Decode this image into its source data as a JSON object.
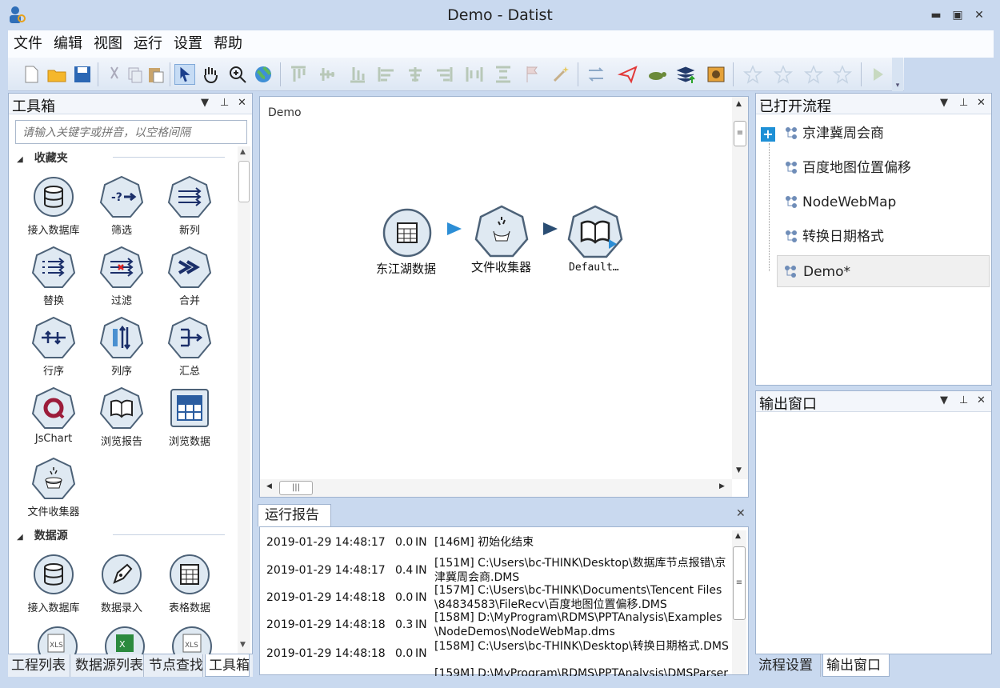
{
  "window": {
    "title": "Demo - Datist",
    "minimize": "▬",
    "maximize": "▣",
    "close": "✕"
  },
  "menu": [
    "文件",
    "编辑",
    "视图",
    "运行",
    "设置",
    "帮助"
  ],
  "toolbox": {
    "title": "工具箱",
    "search_placeholder": "请输入关键字或拼音，以空格间隔",
    "favorites_label": "收藏夹",
    "favorites": [
      "接入数据库",
      "筛选",
      "新列",
      "替换",
      "过滤",
      "合并",
      "行序",
      "列序",
      "汇总",
      "JsChart",
      "浏览报告",
      "浏览数据",
      "文件收集器"
    ],
    "datasource_label": "数据源",
    "datasource": [
      "接入数据库",
      "数据录入",
      "表格数据"
    ],
    "bottom_tabs": [
      "工程列表",
      "数据源列表",
      "节点查找",
      "工具箱"
    ]
  },
  "canvas": {
    "title": "Demo",
    "nodes": [
      "东江湖数据",
      "文件收集器",
      "Default…"
    ]
  },
  "report": {
    "title": "运行报告",
    "rows": [
      {
        "time": "2019-01-29 14:48:17",
        "dur": "0.0",
        "lvl": "IN",
        "msg": "[146M]   初始化结束"
      },
      {
        "time": "2019-01-29 14:48:17",
        "dur": "0.4",
        "lvl": "IN",
        "msg": "[151M]   C:\\Users\\bc-THINK\\Desktop\\数据库节点报错\\京津冀周会商.DMS"
      },
      {
        "time": "2019-01-29 14:48:18",
        "dur": "0.0",
        "lvl": "IN",
        "msg": "[157M]   C:\\Users\\bc-THINK\\Documents\\Tencent Files\\84834583\\FileRecv\\百度地图位置偏移.DMS"
      },
      {
        "time": "2019-01-29 14:48:18",
        "dur": "0.3",
        "lvl": "IN",
        "msg": "[158M]   D:\\MyProgram\\RDMS\\PPTAnalysis\\Examples\\NodeDemos\\NodeWebMap.dms"
      },
      {
        "time": "2019-01-29 14:48:18",
        "dur": "0.0",
        "lvl": "IN",
        "msg": "[158M]   C:\\Users\\bc-THINK\\Desktop\\转换日期格式.DMS"
      },
      {
        "time": "",
        "dur": "",
        "lvl": "",
        "msg": "[159M]   D:\\MyProgram\\RDMS\\PPTAnalysis\\DMSParser"
      }
    ]
  },
  "flows": {
    "title": "已打开流程",
    "items": [
      "京津冀周会商",
      "百度地图位置偏移",
      "NodeWebMap",
      "转换日期格式",
      "Demo*"
    ]
  },
  "output": {
    "title": "输出窗口"
  },
  "right_tabs": [
    "流程设置",
    "输出窗口"
  ],
  "colors": {
    "accent": "#1e90d6",
    "node_fill": "#dfe9f2",
    "node_stroke": "#4d6278",
    "title_bg": "#c9d9ef"
  }
}
